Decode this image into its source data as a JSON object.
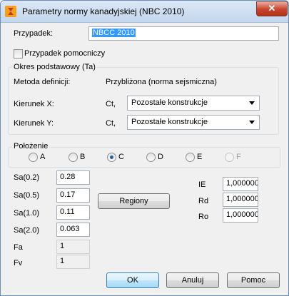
{
  "window": {
    "title": "Parametry normy kanadyjskiej (NBC 2010)",
    "close_label": "✕"
  },
  "case": {
    "label": "Przypadek:",
    "value": "NBCC 2010"
  },
  "auxiliary_case": {
    "label": "Przypadek pomocniczy",
    "checked": false
  },
  "period": {
    "group_title": "Okres podstawowy (Ta)",
    "method_label": "Metoda definicji:",
    "method_value": "Przybliżona (norma sejsmiczna)",
    "dir_x_label": "Kierunek X:",
    "dir_x_ct": "Ct,",
    "dir_x_value": "Pozostałe konstrukcje",
    "dir_y_label": "Kierunek Y:",
    "dir_y_ct": "Ct,",
    "dir_y_value": "Pozostałe konstrukcje"
  },
  "location": {
    "group_title": "Położenie",
    "options": [
      "A",
      "B",
      "C",
      "D",
      "E",
      "F"
    ],
    "selected": "C",
    "disabled": [
      "F"
    ]
  },
  "sa": {
    "sa02_label": "Sa(0.2)",
    "sa02_value": "0.28",
    "sa05_label": "Sa(0.5)",
    "sa05_value": "0.17",
    "sa10_label": "Sa(1.0)",
    "sa10_value": "0.11",
    "sa20_label": "Sa(2.0)",
    "sa20_value": "0.063",
    "fa_label": "Fa",
    "fa_value": "1",
    "fv_label": "Fv",
    "fv_value": "1"
  },
  "regions_button": "Regiony",
  "factors": {
    "ie_label": "IE",
    "ie_value": "1,000000",
    "rd_label": "Rd",
    "rd_value": "1,000000",
    "ro_label": "Ro",
    "ro_value": "1,000000"
  },
  "buttons": {
    "ok": "OK",
    "cancel": "Anuluj",
    "help": "Pomoc"
  }
}
